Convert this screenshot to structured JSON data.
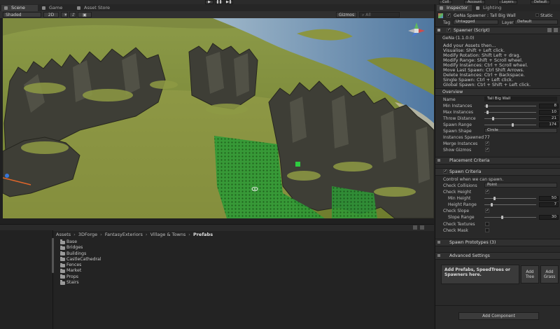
{
  "toolbar": {
    "play_icon": "▶",
    "pause_icon": "❚❚",
    "step_icon": "▶❚",
    "collab": "Coll",
    "account": "Account",
    "layers": "Layers",
    "layout": "Default"
  },
  "scene_tabs": [
    {
      "label": "Scene",
      "icon": "scene-icon"
    },
    {
      "label": "Game",
      "icon": "game-icon"
    },
    {
      "label": "Asset Store",
      "icon": "asset-store-icon"
    }
  ],
  "scene_toolbar": {
    "shading": "Shaded",
    "mode_2d": "2D",
    "gizmos": "Gizmos",
    "search_placeholder": "All"
  },
  "project": {
    "breadcrumb": [
      "Assets",
      "3DForge",
      "FantasyExteriors",
      "Village & Towns",
      "Prefabs"
    ],
    "folders": [
      "Base",
      "Bridges",
      "Buildings",
      "CastleCathedral",
      "Fences",
      "Market",
      "Props",
      "Stairs"
    ]
  },
  "inspector": {
    "tabs": [
      "Inspector",
      "Lighting"
    ],
    "object_name": "GeNa Spawner : Tall Big Wall",
    "static_label": "Static",
    "tag_label": "Tag",
    "tag_value": "Untagged",
    "layer_label": "Layer",
    "layer_value": "Default",
    "component_title": "Spawner (Script)",
    "version": "GeNa (1.1.0.0)",
    "help_lines": [
      "Add your Assets then...",
      "Visualise: Shift + Left click.",
      "Modify Rotation: Shift Left + drag.",
      "Modify Range: Shift + Scroll wheel.",
      "Modify Instances: Ctrl + Scroll wheel.",
      "Move Last Spawn: Ctrl Shift Arrows.",
      "Delete Instances: Ctrl + Backspace.",
      "Single Spawn: Ctrl + Left click.",
      "Global Spawn: Ctrl + Shift + Left click."
    ],
    "overview_title": "Overview",
    "name_label": "Name",
    "name_value": "Tall Big Wall",
    "fields": [
      {
        "label": "Min Instances",
        "value": "8",
        "fill": 0.03
      },
      {
        "label": "Max Instances",
        "value": "10",
        "fill": 0.04
      },
      {
        "label": "Throw Distance",
        "value": "21",
        "fill": 0.15
      },
      {
        "label": "Spawn Range",
        "value": "174",
        "fill": 0.55
      }
    ],
    "spawn_shape_label": "Spawn Shape",
    "spawn_shape_value": "Circle",
    "instances_spawned_label": "Instances Spawned",
    "instances_spawned_value": "77",
    "merge_instances_label": "Merge Instances",
    "show_gizmos_label": "Show Gizmos",
    "placement_title": "Placement Criteria",
    "spawn_criteria_title": "Spawn Criteria",
    "spawn_criteria_desc": "Control when we can spawn.",
    "check_collisions_label": "Check Collisions",
    "check_collisions_value": "Point",
    "check_height_label": "Check Height",
    "min_height_label": "Min Height",
    "min_height_value": "50",
    "height_range_label": "Height Range",
    "height_range_value": "7",
    "check_slope_label": "Check Slope",
    "slope_range_label": "Slope Range",
    "slope_range_value": "30",
    "check_textures_label": "Check Textures",
    "check_mask_label": "Check Mask",
    "spawn_prototypes_title": "Spawn Prototypes (3)",
    "advanced_title": "Advanced Settings",
    "drop_text": "Add Prefabs, SpeedTrees or Spawners here.",
    "add_tree_label": "Add Tree",
    "add_grass_label": "Add Grass",
    "add_component_label": "Add Component"
  },
  "colors": {
    "panel": "#292929",
    "section": "#303030",
    "grass": "#7e8b38",
    "water": "#6b8fb0",
    "rock": "#3e3e36",
    "spawn_grid": "#1f8a2a"
  }
}
